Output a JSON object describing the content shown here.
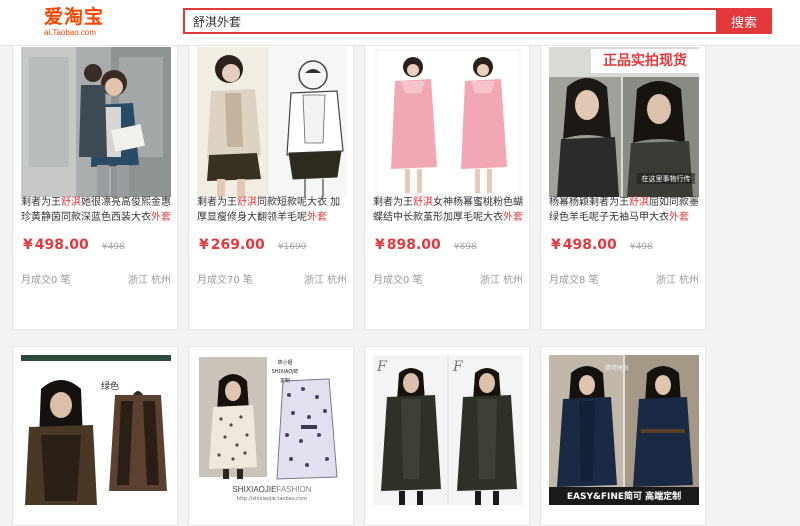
{
  "header": {
    "logo_main": "爱淘宝",
    "logo_sub": "ai.Taobao.com",
    "search_value": "舒淇外套",
    "search_button": "搜索"
  },
  "products": [
    {
      "title_pre": "剩者为王",
      "kw1": "舒淇",
      "title_mid": "她很漂亮高俊熙金惠珍黄静茵同款深蓝色西装大衣",
      "kw2": "外套",
      "price": "498.00",
      "orig": "498",
      "sales": "月成交0 笔",
      "location": "浙江 杭州"
    },
    {
      "title_pre": "剩者为王",
      "kw1": "舒淇",
      "title_mid": "同款短款呢大衣 加厚显瘦修身大翻领羊毛呢",
      "kw2": "外套",
      "price": "269.00",
      "orig": "1699",
      "sales": "月成交70 笔",
      "location": "浙江 杭州"
    },
    {
      "title_pre": "剩者为王",
      "kw1": "舒淇",
      "title_mid": "女神杨幂蜜桃粉色蝴蝶结中长款茧形加厚毛呢大衣",
      "kw2": "外套",
      "price": "898.00",
      "orig": "898",
      "sales": "月成交0 笔",
      "location": "浙江 杭州"
    },
    {
      "title_pre": "杨幂杨颖剩者为王",
      "kw1": "舒淇",
      "title_mid": "屈如同款墨绿色羊毛呢子无袖马甲大衣",
      "kw2": "外套",
      "price": "498.00",
      "orig": "498",
      "sales": "月成交8 笔",
      "location": "浙江 杭州"
    }
  ],
  "thumb_text": {
    "badge": "正品实拍现货",
    "caption4": "在这里事物行传",
    "green": "绿色",
    "brand_tag": "饰小姐\nSHIXIAOJIE\n定制",
    "brand_caption_a": "SHIXIAOJIE",
    "brand_caption_b": "FASHION",
    "store_url": "http://shixiaojie.taobao.com",
    "easy_fine": "EASY&FINE简可 高端定制",
    "watermark8": "简可时尚"
  },
  "colors": {
    "accent": "#e4393c",
    "logo": "#ff4400"
  }
}
